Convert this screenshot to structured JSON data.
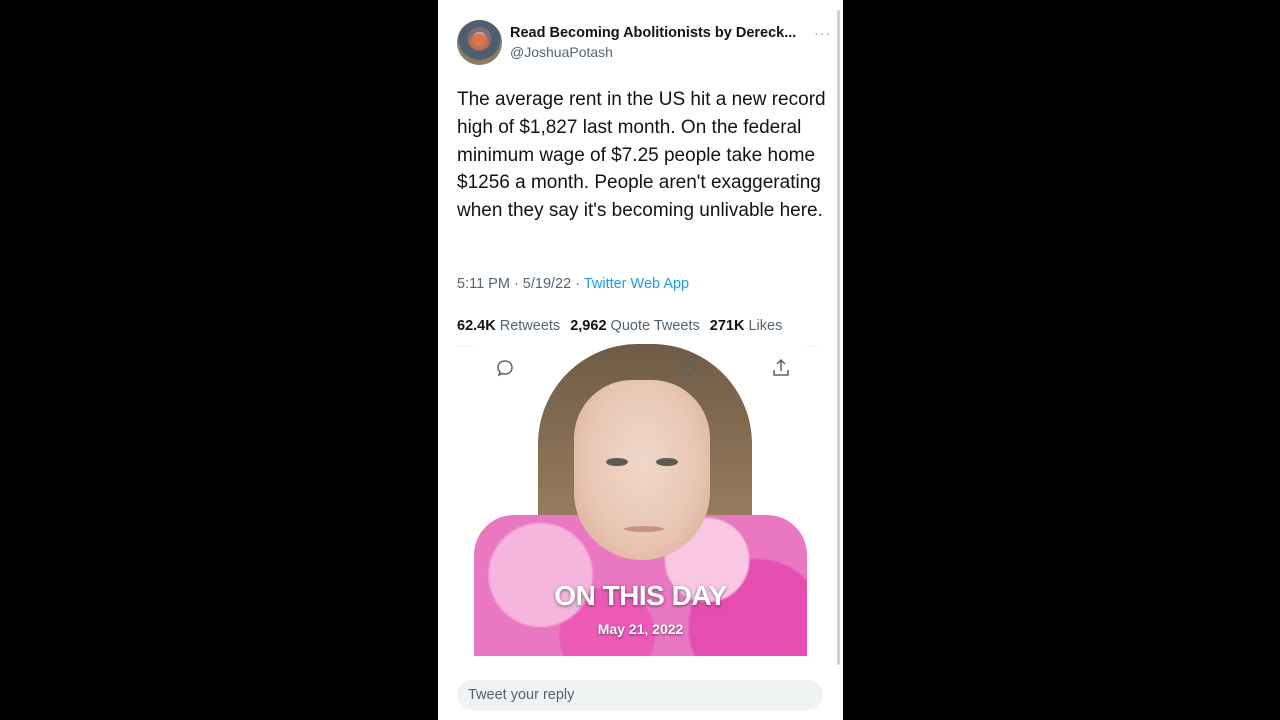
{
  "tweet": {
    "display_name": "Read Becoming Abolitionists by Dereck...",
    "handle": "@JoshuaPotash",
    "more": "···",
    "text": "The average rent in the US hit a new record high of $1,827 last month. On the federal minimum wage of $7.25 people take home $1256 a month. People aren't exaggerating when they say it's becoming unlivable here.",
    "time_date": "5:11 PM · 5/19/22 · ",
    "source": "Twitter Web App",
    "stats": {
      "retweets_count": "62.4K",
      "retweets_label": "Retweets",
      "quotes_count": "2,962",
      "quotes_label": "Quote Tweets",
      "likes_count": "271K",
      "likes_label": "Likes"
    }
  },
  "video_overlay": {
    "title": "ON THIS DAY",
    "date": "May 21, 2022"
  },
  "reply": {
    "placeholder": "Tweet your reply"
  },
  "icons": {
    "reply": "reply-icon",
    "like": "heart-icon",
    "share": "share-icon",
    "more": "more-icon"
  }
}
